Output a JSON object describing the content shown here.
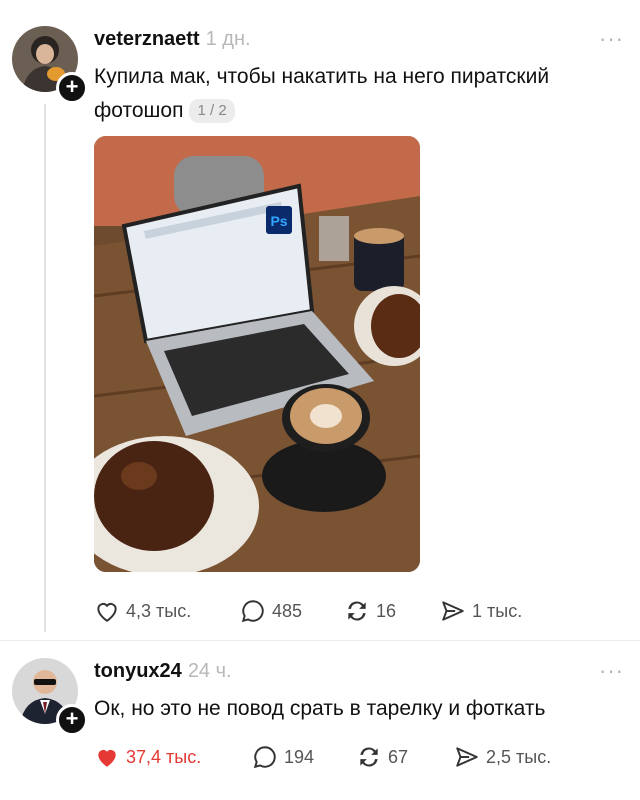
{
  "posts": [
    {
      "username": "veterznaett",
      "time": "1 дн.",
      "more": "···",
      "text": "Купила мак, чтобы накатить на него пиратский фотошоп",
      "page_indicator": "1 / 2",
      "photo": {
        "overlay_label": "Ps"
      },
      "actions": {
        "likes": "4,3 тыс.",
        "comments": "485",
        "reposts": "16",
        "shares": "1 тыс."
      },
      "liked": false
    },
    {
      "username": "tonyux24",
      "time": "24 ч.",
      "more": "···",
      "text": "Ок, но это не повод срать в тарелку и фоткать",
      "actions": {
        "likes": "37,4 тыс.",
        "comments": "194",
        "reposts": "67",
        "shares": "2,5 тыс."
      },
      "liked": true
    }
  ],
  "colors": {
    "like_active": "#e53935",
    "meta_gray": "#b8b8b8",
    "icon_gray": "#555555"
  }
}
